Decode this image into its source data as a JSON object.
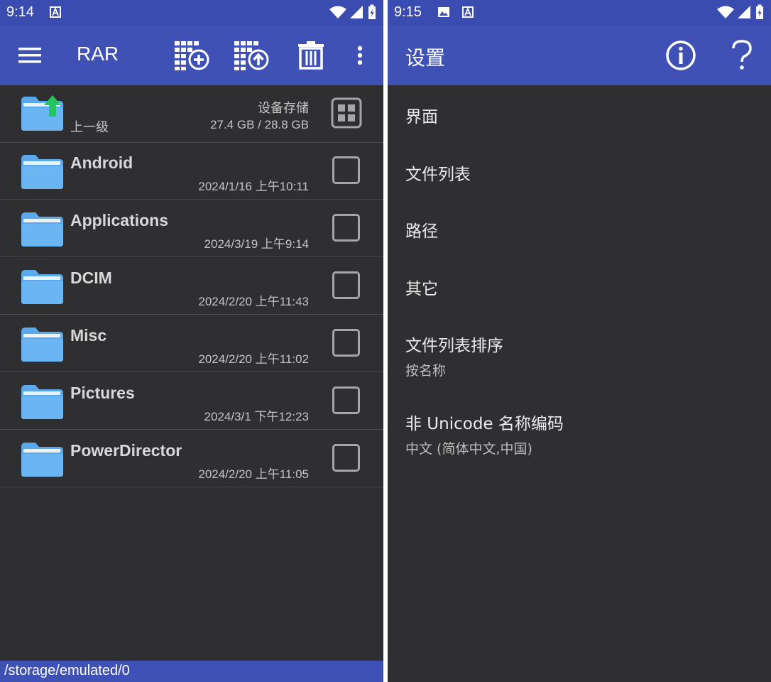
{
  "left": {
    "status": {
      "time": "9:14"
    },
    "appbar": {
      "title": "RAR",
      "icons": [
        "menu-icon",
        "add-archive-icon",
        "extract-archive-icon",
        "delete-icon",
        "more-vert-icon"
      ]
    },
    "parent_row": {
      "label": "上一级",
      "storage_name": "设备存储",
      "storage_usage": "27.4 GB / 28.8 GB"
    },
    "files": [
      {
        "name": "Android",
        "date": "2024/1/16 上午10:11"
      },
      {
        "name": "Applications",
        "date": "2024/3/19 上午9:14"
      },
      {
        "name": "DCIM",
        "date": "2024/2/20 上午11:43"
      },
      {
        "name": "Misc",
        "date": "2024/2/20 上午11:02"
      },
      {
        "name": "Pictures",
        "date": "2024/3/1 下午12:23"
      },
      {
        "name": "PowerDirector",
        "date": "2024/2/20 上午11:05"
      }
    ],
    "path": "/storage/emulated/0"
  },
  "right": {
    "status": {
      "time": "9:15"
    },
    "appbar": {
      "title": "设置",
      "icons": [
        "info-icon",
        "help-icon"
      ]
    },
    "settings": [
      {
        "title": "界面"
      },
      {
        "title": "文件列表"
      },
      {
        "title": "路径"
      },
      {
        "title": "其它"
      },
      {
        "title": "文件列表排序",
        "subtitle": "按名称"
      },
      {
        "title": "非 Unicode 名称编码",
        "subtitle": "中文 (简体中文,中国)"
      }
    ]
  },
  "colors": {
    "appbar": "#3f51b5",
    "statusbar": "#3a4cb0",
    "background": "#2f2e30",
    "folder": "#5aa9ec",
    "up_arrow": "#22c55e"
  }
}
